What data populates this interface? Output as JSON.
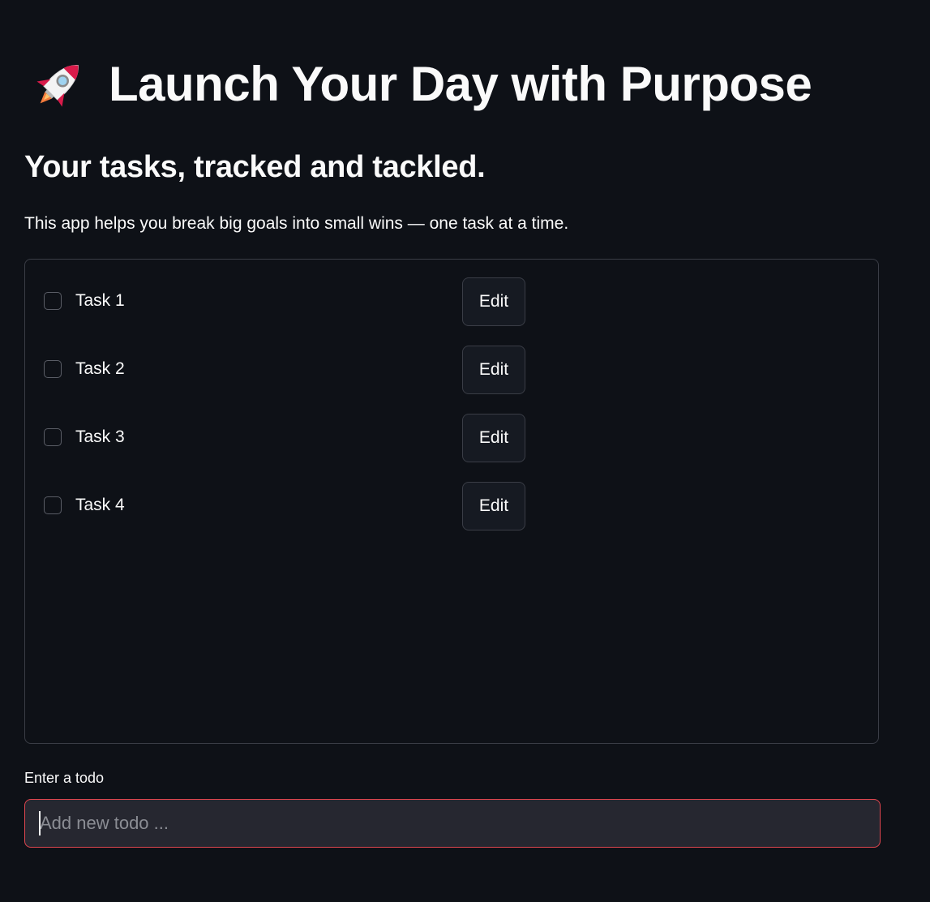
{
  "header": {
    "icon": "rocket-icon",
    "title": "Launch Your Day with Purpose",
    "subtitle": "Your tasks, tracked and tackled.",
    "description": "This app helps you break big goals into small wins — one task at a time."
  },
  "tasks": [
    {
      "label": "Task 1",
      "checked": false,
      "edit_label": "Edit"
    },
    {
      "label": "Task 2",
      "checked": false,
      "edit_label": "Edit"
    },
    {
      "label": "Task 3",
      "checked": false,
      "edit_label": "Edit"
    },
    {
      "label": "Task 4",
      "checked": false,
      "edit_label": "Edit"
    }
  ],
  "todo_input": {
    "label": "Enter a todo",
    "placeholder": "Add new todo ...",
    "value": ""
  },
  "colors": {
    "background": "#0e1117",
    "text": "#fafafa",
    "focus_border": "#e0464f",
    "input_background": "#262730"
  }
}
